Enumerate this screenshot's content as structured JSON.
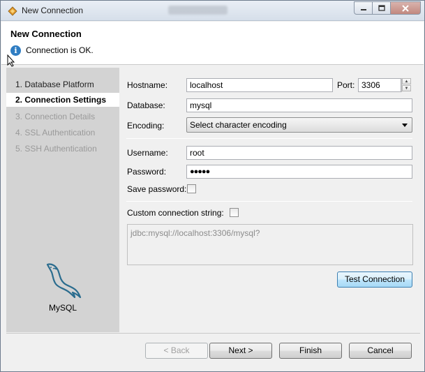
{
  "window": {
    "title": "New Connection"
  },
  "banner": {
    "title": "New Connection",
    "message": "Connection is OK."
  },
  "steps": [
    {
      "label": "1. Database Platform",
      "state": "done"
    },
    {
      "label": "2. Connection Settings",
      "state": "active"
    },
    {
      "label": "3. Connection Details",
      "state": "disabled"
    },
    {
      "label": "4. SSL Authentication",
      "state": "disabled"
    },
    {
      "label": "5. SSH Authentication",
      "state": "disabled"
    }
  ],
  "platform": {
    "name": "MySQL",
    "icon": "mysql-dolphin-icon"
  },
  "form": {
    "hostname_label": "Hostname:",
    "hostname_value": "localhost",
    "port_label": "Port:",
    "port_value": "3306",
    "database_label": "Database:",
    "database_value": "mysql",
    "encoding_label": "Encoding:",
    "encoding_value": "Select character encoding",
    "username_label": "Username:",
    "username_value": "root",
    "password_label": "Password:",
    "password_value": "●●●●●",
    "save_password_label": "Save password:",
    "save_password_checked": false,
    "custom_string_label": "Custom connection string:",
    "custom_string_checked": false,
    "custom_string_value": "jdbc:mysql://localhost:3306/mysql?",
    "test_connection_label": "Test Connection"
  },
  "footer": {
    "back_label": "< Back",
    "next_label": "Next >",
    "finish_label": "Finish",
    "cancel_label": "Cancel"
  },
  "colors": {
    "accent": "#2f7dc2",
    "dolphin": "#2a6c8e",
    "left_panel": "#d3d3d3"
  }
}
